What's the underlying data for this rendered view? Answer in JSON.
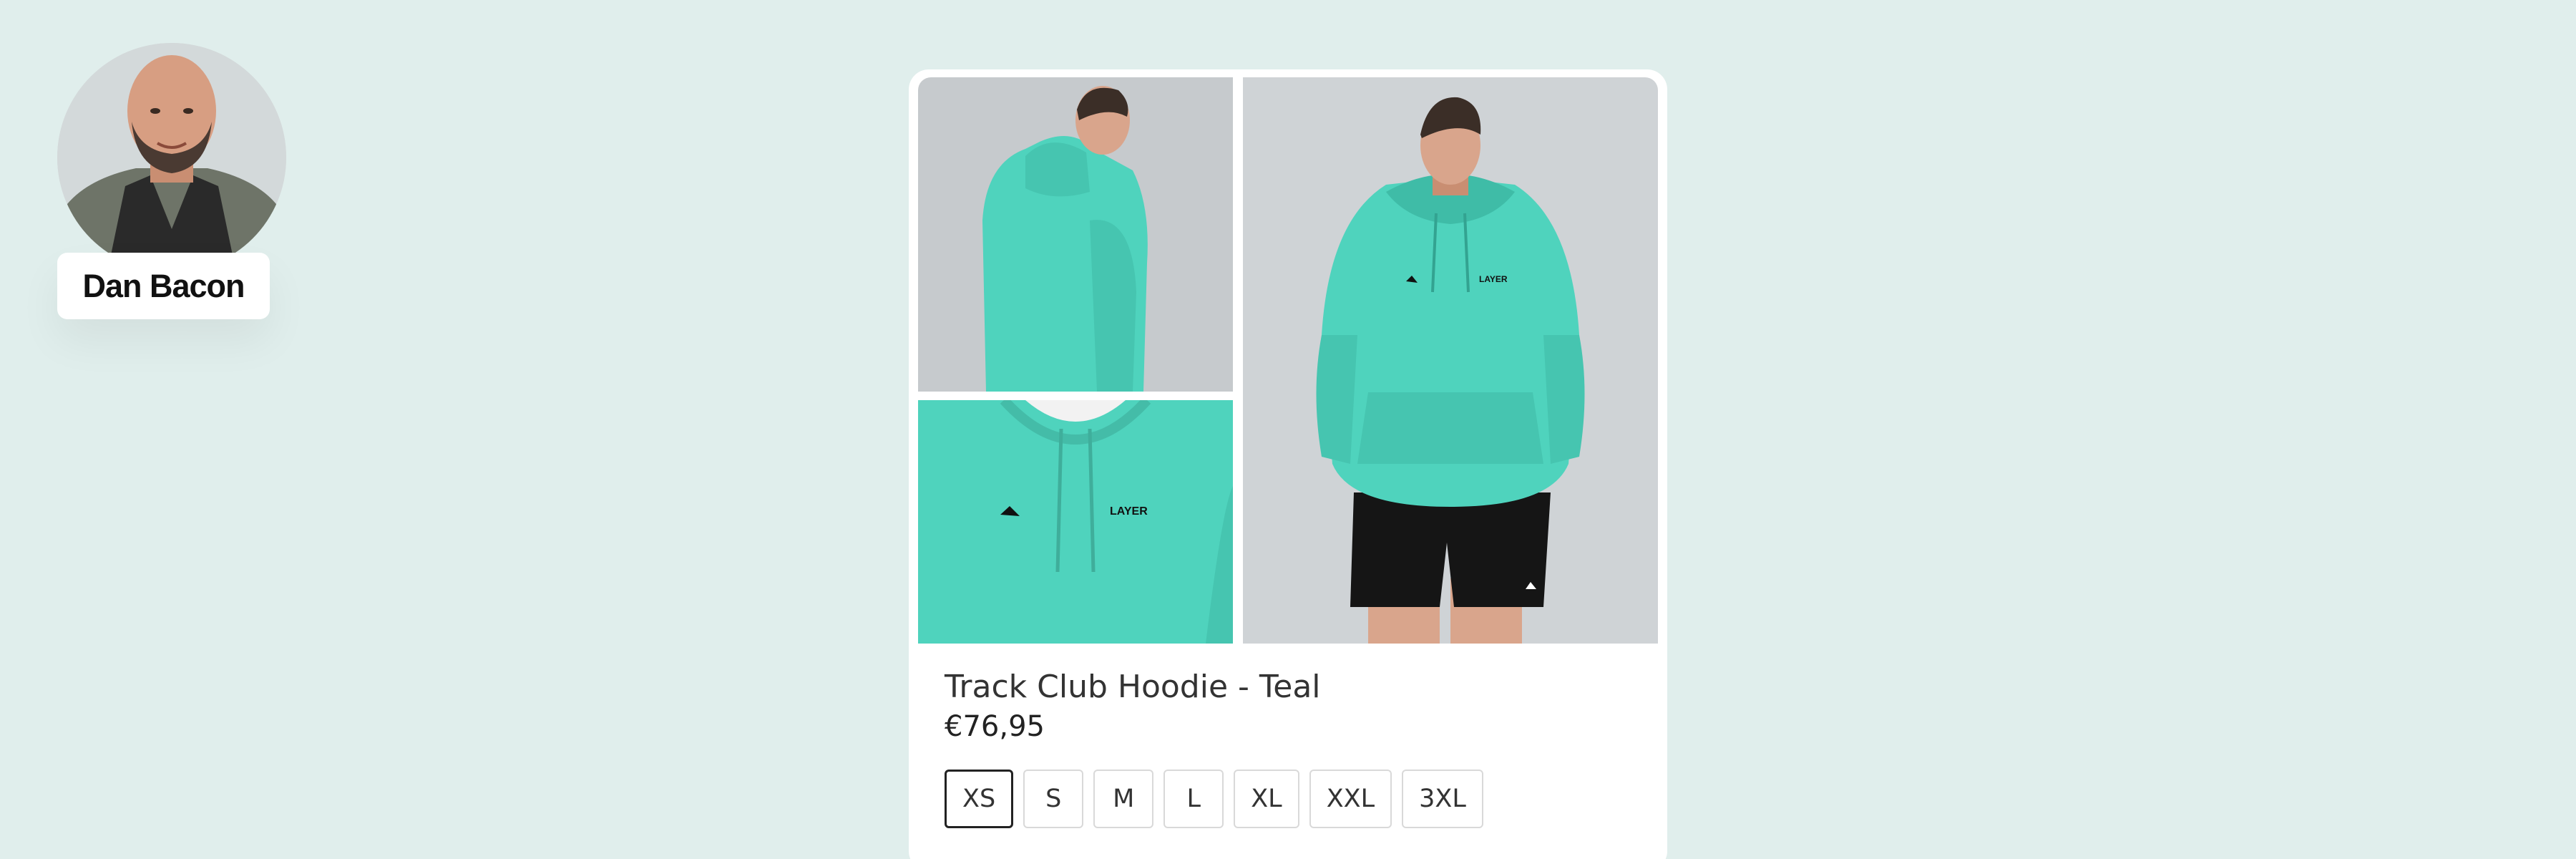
{
  "profile": {
    "name": "Dan Bacon"
  },
  "product": {
    "title": "Track Club Hoodie - Teal",
    "price": "€76,95",
    "brand_print": "LAYER",
    "color": "#4fd3bd",
    "images": [
      {
        "view": "back"
      },
      {
        "view": "chest-detail"
      },
      {
        "view": "front"
      }
    ],
    "sizes": [
      {
        "label": "XS",
        "selected": true
      },
      {
        "label": "S",
        "selected": false
      },
      {
        "label": "M",
        "selected": false
      },
      {
        "label": "L",
        "selected": false
      },
      {
        "label": "XL",
        "selected": false
      },
      {
        "label": "XXL",
        "selected": false
      },
      {
        "label": "3XL",
        "selected": false
      }
    ]
  }
}
